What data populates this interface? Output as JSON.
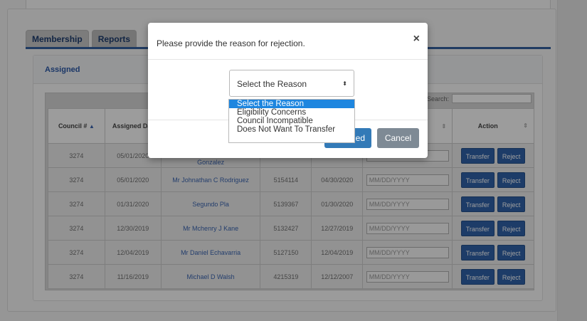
{
  "tabs": [
    {
      "label": "Membership"
    },
    {
      "label": "Reports"
    }
  ],
  "assigned": {
    "title": "Assigned"
  },
  "table": {
    "search_label": "Search:",
    "headers": {
      "council": "Council #",
      "assigned_date": "Assigned Date",
      "action": "Action"
    },
    "date_placeholder": "MM/DD/YYYY",
    "transfer_label": "Transfer",
    "reject_label": "Reject",
    "rows": [
      {
        "council": "3274",
        "assigned": "05/01/2020",
        "name": "Gonzalez",
        "member_no": "",
        "date": ""
      },
      {
        "council": "3274",
        "assigned": "05/01/2020",
        "name": "Mr Johnathan C Rodriguez",
        "member_no": "5154114",
        "date": "04/30/2020"
      },
      {
        "council": "3274",
        "assigned": "01/31/2020",
        "name": "Segundo Pla",
        "member_no": "5139367",
        "date": "01/30/2020"
      },
      {
        "council": "3274",
        "assigned": "12/30/2019",
        "name": "Mr Mchenry J Kane",
        "member_no": "5132427",
        "date": "12/27/2019"
      },
      {
        "council": "3274",
        "assigned": "12/04/2019",
        "name": "Mr Daniel Echavarria",
        "member_no": "5127150",
        "date": "12/04/2019"
      },
      {
        "council": "3274",
        "assigned": "11/16/2019",
        "name": "Michael D Walsh",
        "member_no": "4215319",
        "date": "12/12/2007"
      }
    ]
  },
  "modal": {
    "title": "Please provide the reason for rejection.",
    "close": "×",
    "select_value": "Select the Reason",
    "select_arrow": "⬍",
    "proceed_label": "ed",
    "cancel_label": "Cancel"
  },
  "dropdown": {
    "options": [
      "Select the Reason",
      "Eligibility Concerns",
      "Council Incompatible",
      "Does Not Want To Transfer"
    ]
  },
  "colors": {
    "accent": "#337ab7",
    "highlight": "#1e86df",
    "button": "#2f62a8"
  }
}
